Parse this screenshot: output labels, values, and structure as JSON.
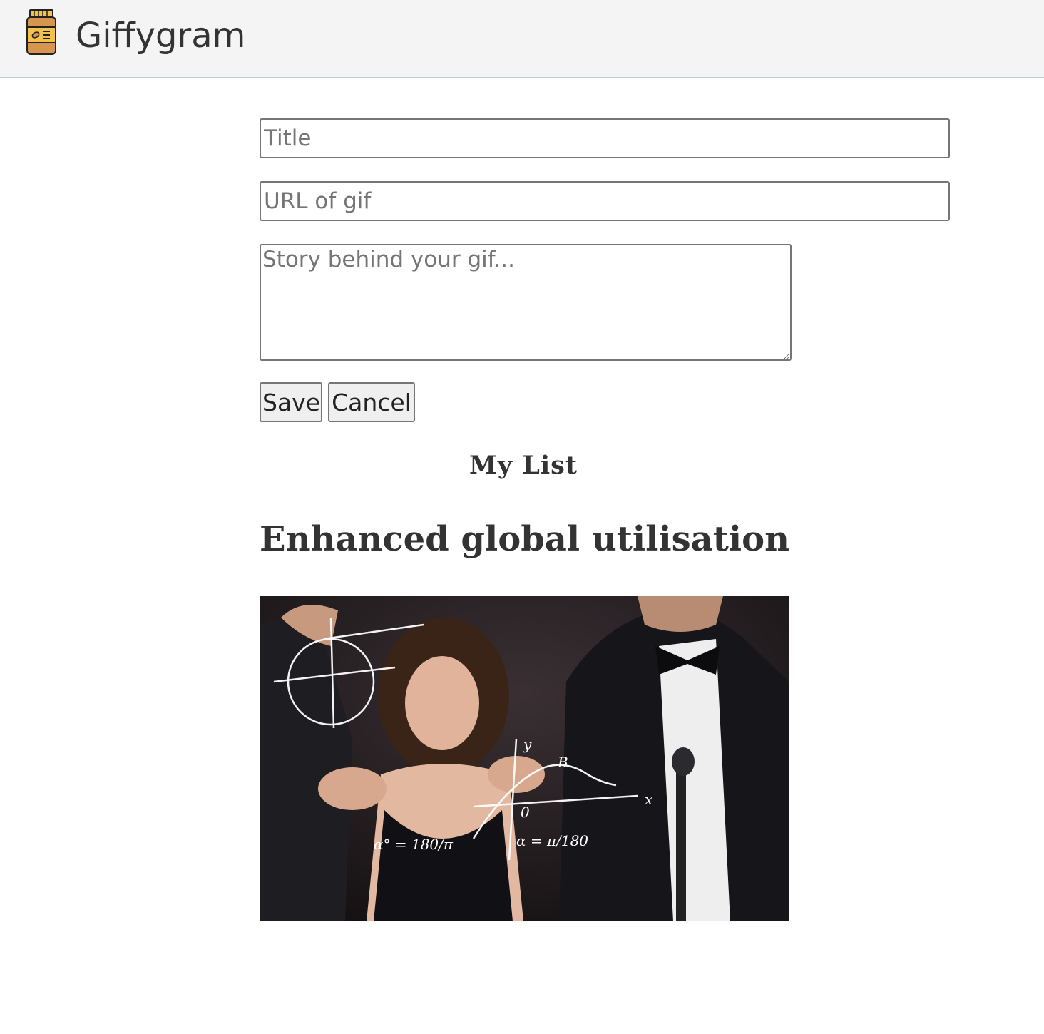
{
  "header": {
    "brand": "Giffygram",
    "logo_icon": "jar-icon"
  },
  "form": {
    "title_placeholder": "Title",
    "url_placeholder": "URL of gif",
    "story_placeholder": "Story behind your gif...",
    "save_label": "Save",
    "cancel_label": "Cancel"
  },
  "list": {
    "heading": "My List",
    "entries": [
      {
        "title": "Enhanced global utilisation",
        "image_desc": "math-calculation-gif"
      }
    ]
  }
}
